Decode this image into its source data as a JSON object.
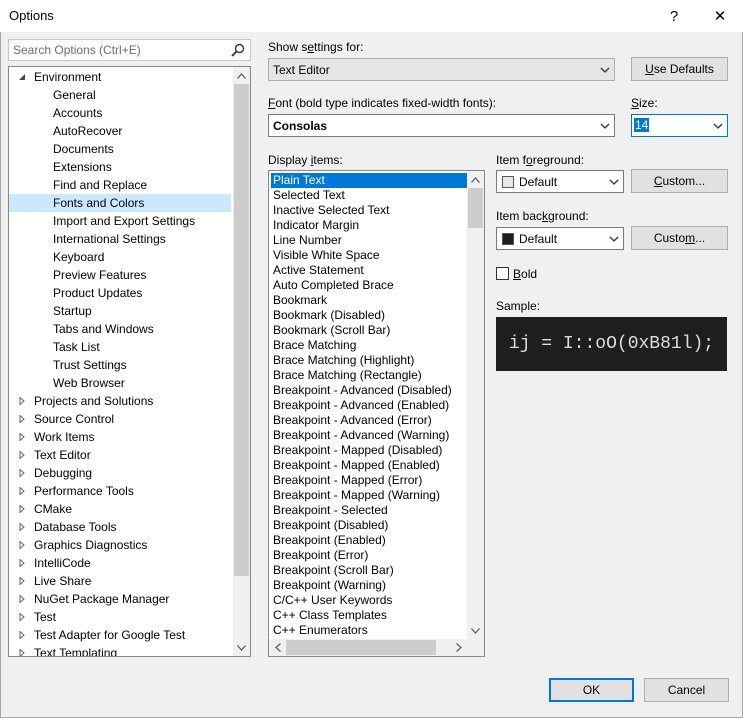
{
  "window": {
    "title": "Options",
    "help_glyph": "?",
    "close_glyph": "✕"
  },
  "search": {
    "placeholder": "Search Options (Ctrl+E)"
  },
  "tree": {
    "items": [
      {
        "label": "Environment",
        "level": 0,
        "expandable": true,
        "expanded": true
      },
      {
        "label": "General",
        "level": 1
      },
      {
        "label": "Accounts",
        "level": 1
      },
      {
        "label": "AutoRecover",
        "level": 1
      },
      {
        "label": "Documents",
        "level": 1
      },
      {
        "label": "Extensions",
        "level": 1
      },
      {
        "label": "Find and Replace",
        "level": 1
      },
      {
        "label": "Fonts and Colors",
        "level": 1,
        "selected": true
      },
      {
        "label": "Import and Export Settings",
        "level": 1
      },
      {
        "label": "International Settings",
        "level": 1
      },
      {
        "label": "Keyboard",
        "level": 1
      },
      {
        "label": "Preview Features",
        "level": 1
      },
      {
        "label": "Product Updates",
        "level": 1
      },
      {
        "label": "Startup",
        "level": 1
      },
      {
        "label": "Tabs and Windows",
        "level": 1
      },
      {
        "label": "Task List",
        "level": 1
      },
      {
        "label": "Trust Settings",
        "level": 1
      },
      {
        "label": "Web Browser",
        "level": 1
      },
      {
        "label": "Projects and Solutions",
        "level": 0,
        "expandable": true
      },
      {
        "label": "Source Control",
        "level": 0,
        "expandable": true
      },
      {
        "label": "Work Items",
        "level": 0,
        "expandable": true
      },
      {
        "label": "Text Editor",
        "level": 0,
        "expandable": true
      },
      {
        "label": "Debugging",
        "level": 0,
        "expandable": true
      },
      {
        "label": "Performance Tools",
        "level": 0,
        "expandable": true
      },
      {
        "label": "CMake",
        "level": 0,
        "expandable": true
      },
      {
        "label": "Database Tools",
        "level": 0,
        "expandable": true
      },
      {
        "label": "Graphics Diagnostics",
        "level": 0,
        "expandable": true
      },
      {
        "label": "IntelliCode",
        "level": 0,
        "expandable": true
      },
      {
        "label": "Live Share",
        "level": 0,
        "expandable": true
      },
      {
        "label": "NuGet Package Manager",
        "level": 0,
        "expandable": true
      },
      {
        "label": "Test",
        "level": 0,
        "expandable": true
      },
      {
        "label": "Test Adapter for Google Test",
        "level": 0,
        "expandable": true
      },
      {
        "label": "Text Templating",
        "level": 0,
        "expandable": true
      }
    ]
  },
  "settings": {
    "show_settings_for": {
      "label_pre": "Show s",
      "label_ul": "e",
      "label_post": "ttings for:",
      "value": "Text Editor"
    },
    "use_defaults": {
      "ul": "U",
      "rest": "se Defaults"
    },
    "font": {
      "label_ul": "F",
      "label_post": "ont (bold type indicates fixed-width fonts):",
      "value": "Consolas"
    },
    "size": {
      "label_ul": "S",
      "label_post": "ize:",
      "value": "14"
    },
    "display_items": {
      "label_pre": "Display ",
      "label_ul": "i",
      "label_post": "tems:"
    },
    "items": [
      "Plain Text",
      "Selected Text",
      "Inactive Selected Text",
      "Indicator Margin",
      "Line Number",
      "Visible White Space",
      "Active Statement",
      "Auto Completed Brace",
      "Bookmark",
      "Bookmark (Disabled)",
      "Bookmark (Scroll Bar)",
      "Brace Matching",
      "Brace Matching (Highlight)",
      "Brace Matching (Rectangle)",
      "Breakpoint - Advanced (Disabled)",
      "Breakpoint - Advanced (Enabled)",
      "Breakpoint - Advanced (Error)",
      "Breakpoint - Advanced (Warning)",
      "Breakpoint - Mapped (Disabled)",
      "Breakpoint - Mapped (Enabled)",
      "Breakpoint - Mapped (Error)",
      "Breakpoint - Mapped (Warning)",
      "Breakpoint - Selected",
      "Breakpoint (Disabled)",
      "Breakpoint (Enabled)",
      "Breakpoint (Error)",
      "Breakpoint (Scroll Bar)",
      "Breakpoint (Warning)",
      "C/C++ User Keywords",
      "C++ Class Templates",
      "C++ Enumerators"
    ],
    "selected_item": "Plain Text",
    "item_foreground": {
      "label_pre": "Item f",
      "label_ul": "o",
      "label_post": "reground:",
      "value": "Default",
      "swatch": "#e8e8e8"
    },
    "item_background": {
      "label_pre": "Item bac",
      "label_ul": "k",
      "label_post": "ground:",
      "value": "Default",
      "swatch": "#1e1e1e"
    },
    "custom_fg": {
      "ul": "C",
      "rest": "ustom..."
    },
    "custom_bg": {
      "pre": "Custo",
      "ul": "m",
      "rest": "..."
    },
    "bold": {
      "ul": "B",
      "rest": "old",
      "checked": false
    },
    "sample": {
      "label": "Sample:",
      "text": "ij = I::oO(0xB81l);"
    }
  },
  "footer": {
    "ok": "OK",
    "cancel": "Cancel"
  },
  "colors": {
    "accent": "#0078d7",
    "selection_light": "#cce8ff",
    "sample_bg": "#1e1e1e"
  }
}
